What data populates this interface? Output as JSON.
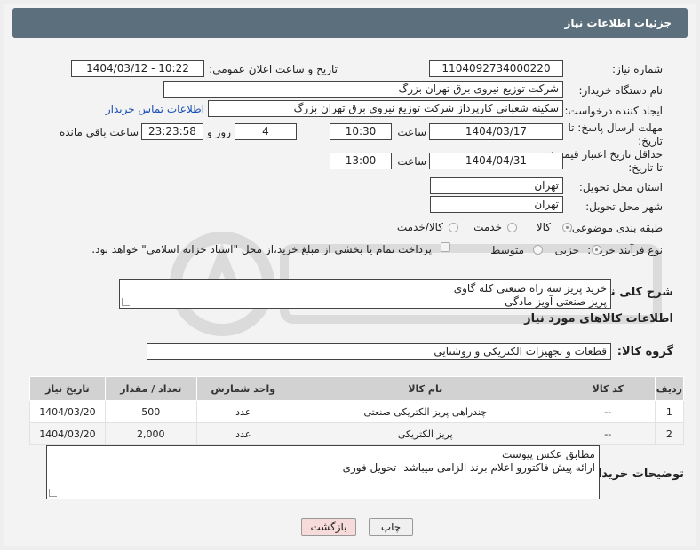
{
  "header": {
    "title": "جزئیات اطلاعات نیاز"
  },
  "fields": {
    "need_number_label": "شماره نیاز:",
    "need_number": "1104092734000220",
    "announce_label": "تاریخ و ساعت اعلان عمومی:",
    "announce_value": "1404/03/12 - 10:22",
    "buyer_org_label": "نام دستگاه خریدار:",
    "buyer_org": "شرکت توزیع نیروی برق تهران بزرگ",
    "creator_label": "ایجاد کننده درخواست:",
    "creator": "سکینه شعبانی کارپرداز شرکت توزیع نیروی برق تهران بزرگ",
    "contact_link": "اطلاعات تماس خریدار",
    "deadline_label_1": "مهلت ارسال پاسخ: تا",
    "deadline_label_2": "تاریخ:",
    "deadline_date": "1404/03/17",
    "time_label": "ساعت",
    "deadline_time": "10:30",
    "days_value": "4",
    "days_label": "روز و",
    "remaining_time": "23:23:58",
    "remaining_label": "ساعت باقی مانده",
    "price_validity_label_1": "حداقل تاریخ اعتبار قیمت:",
    "price_validity_label_2": "تا تاریخ:",
    "price_validity_date": "1404/04/31",
    "price_validity_time": "13:00",
    "delivery_province_label": "استان محل تحویل:",
    "delivery_province": "تهران",
    "delivery_city_label": "شهر محل تحویل:",
    "delivery_city": "تهران",
    "category_label": "طبقه بندی موضوعی:",
    "category_options": [
      "کالا",
      "خدمت",
      "کالا/خدمت"
    ],
    "process_label": "نوع فرآیند خرید :",
    "process_options": [
      "جزیی",
      "متوسط"
    ],
    "payment_note": "پرداخت تمام یا بخشی از مبلغ خرید،از محل \"اسناد خزانه اسلامی\" خواهد بود."
  },
  "description": {
    "label": "شرح کلی نیاز:",
    "line1": "خرید پریز سه راه صنعتی کله گاوی",
    "line2": "پریز صنعتی آویز مادگی"
  },
  "goods_section": {
    "title": "اطلاعات کالاهای مورد نیاز",
    "group_label": "گروه کالا:",
    "group_value": "قطعات و تجهیزات الکتریکی و روشنایی"
  },
  "table": {
    "headers": [
      "ردیف",
      "کد کالا",
      "نام کالا",
      "واحد شمارش",
      "تعداد / مقدار",
      "تاریخ نیاز"
    ],
    "rows": [
      [
        "1",
        "--",
        "چندراهی پریز الکتریکی صنعتی",
        "عدد",
        "500",
        "1404/03/20"
      ],
      [
        "2",
        "--",
        "پریز الکتریکی",
        "عدد",
        "2,000",
        "1404/03/20"
      ]
    ]
  },
  "buyer_notes": {
    "label": "توضیحات خریدار:",
    "line1": "مطابق عکس پیوست",
    "line2": "ارائه پیش فاکتورو اعلام  برند الزامی میباشد- تحویل فوری"
  },
  "buttons": {
    "print": "چاپ",
    "back": "بازگشت"
  },
  "colors": {
    "header_bg": "#5c6f7c",
    "link": "#1a4fb5",
    "back_button_bg": "#f7dada"
  }
}
